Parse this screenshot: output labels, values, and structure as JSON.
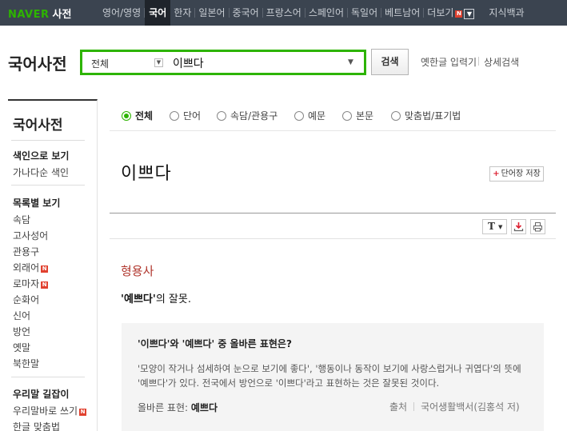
{
  "topbar": {
    "logo_naver": "NAVER",
    "logo_sajeon": "사전",
    "nav": [
      {
        "label": "영어/영영",
        "active": false
      },
      {
        "label": "국어",
        "active": true
      },
      {
        "label": "한자",
        "active": false
      },
      {
        "label": "일본어",
        "active": false
      },
      {
        "label": "중국어",
        "active": false
      },
      {
        "label": "프랑스어",
        "active": false
      },
      {
        "label": "스페인어",
        "active": false
      },
      {
        "label": "독일어",
        "active": false
      },
      {
        "label": "베트남어",
        "active": false
      },
      {
        "label": "더보기",
        "active": false
      },
      {
        "label": "지식백과",
        "active": false
      }
    ],
    "badge": "N",
    "more_icon": "chevron-down-icon"
  },
  "header": {
    "brand": "국어사전",
    "search": {
      "category": "전체",
      "query": "이쁘다"
    },
    "search_button": "검색",
    "links": [
      "옛한글 입력기",
      "상세검색"
    ]
  },
  "sidebar": {
    "title": "국어사전",
    "items": [
      {
        "label": "색인으로 보기",
        "head": true
      },
      {
        "label": "가나다순 색인",
        "head": false
      },
      {
        "label": "목록별 보기",
        "head": true
      },
      {
        "label": "속담",
        "head": false
      },
      {
        "label": "고사성어",
        "head": false
      },
      {
        "label": "관용구",
        "head": false
      },
      {
        "label": "외래어",
        "head": false,
        "badge": "N"
      },
      {
        "label": "로마자",
        "head": false,
        "badge": "N"
      },
      {
        "label": "순화어",
        "head": false
      },
      {
        "label": "신어",
        "head": false
      },
      {
        "label": "방언",
        "head": false
      },
      {
        "label": "옛말",
        "head": false
      },
      {
        "label": "북한말",
        "head": false
      },
      {
        "label": "우리말 길잡이",
        "head": true
      },
      {
        "label": "우리말바로 쓰기",
        "head": false,
        "badge": "N"
      },
      {
        "label": "한글 맞춤법",
        "head": false
      }
    ]
  },
  "tabs": [
    {
      "label": "전체",
      "checked": true
    },
    {
      "label": "단어",
      "checked": false
    },
    {
      "label": "속담/관용구",
      "checked": false
    },
    {
      "label": "예문",
      "checked": false
    },
    {
      "label": "본문",
      "checked": false
    },
    {
      "label": "맞춤법/표기법",
      "checked": false
    }
  ],
  "entry": {
    "word": "이쁘다",
    "wordbook_button": "단어장 저장",
    "toolbar": {
      "font_button": "T",
      "font_icon": "font-size-icon",
      "save_icon": "download-icon",
      "print_icon": "print-icon"
    },
    "pos": "형용사",
    "definition_word": "'예쁘다'",
    "definition_rest": "의 잘못."
  },
  "usage": {
    "question": "'이쁘다'와 '예쁘다' 중 올바른 표현은?",
    "text": "'모양이 작거나 섬세하여 눈으로 보기에 좋다', '행동이나 동작이 보기에 사랑스럽거나 귀엽다'의 뜻에 '예쁘다'가 있다. 전국에서 방언으로 '이쁘다'라고 표현하는 것은 잘못된 것이다.",
    "correct_label": "올바른 표현:",
    "correct_value": "예쁘다",
    "source_label": "출처",
    "source_value": "국어생활백서(김홍석 저)"
  },
  "colors": {
    "accent_green": "#2db400",
    "topbar_bg": "#3b4450",
    "pos_red": "#b0362d"
  }
}
